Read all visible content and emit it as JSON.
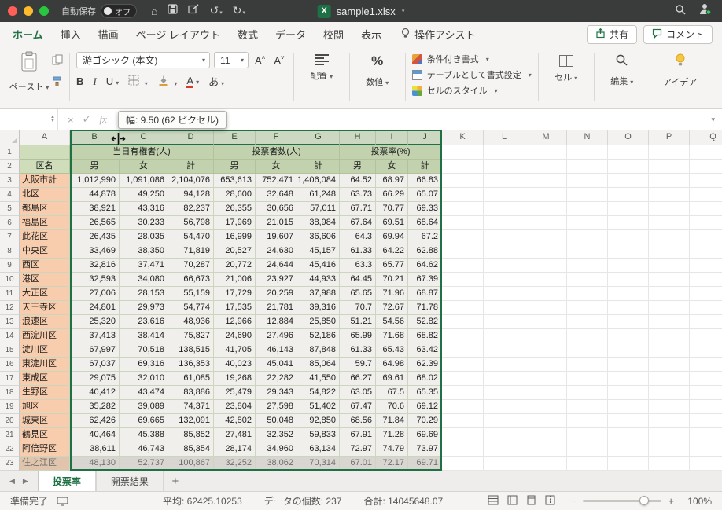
{
  "colors": {
    "accent_green": "#217346",
    "selection_border": "#1f7145",
    "header_fill": "#cfddbb",
    "name_column_fill": "#f8cdad",
    "titlebar_background": "#3a3c3b"
  },
  "titlebar": {
    "autosave_label": "自動保存",
    "autosave_state": "オフ",
    "filename": "sample1.xlsx",
    "icons": {
      "home": "⌂",
      "undo": "↺",
      "redo": "↻"
    }
  },
  "ribbon_tabs": {
    "tabs": [
      {
        "label": "ホーム"
      },
      {
        "label": "挿入"
      },
      {
        "label": "描画"
      },
      {
        "label": "ページ レイアウト"
      },
      {
        "label": "数式"
      },
      {
        "label": "データ"
      },
      {
        "label": "校閲"
      },
      {
        "label": "表示"
      }
    ],
    "active_tab": "ホーム",
    "assistant_label": "操作アシスト",
    "share_label": "共有",
    "comments_label": "コメント"
  },
  "ribbon": {
    "paste_label": "ペースト",
    "font_name": "游ゴシック (本文)",
    "font_size": "11",
    "icons": {
      "grow_font": "A",
      "shrink_font": "A",
      "bold": "B",
      "italic": "I",
      "underline": "U",
      "percent": "%",
      "phonetic": "あ",
      "font_color": "A"
    },
    "alignment_label": "配置",
    "number_label": "数値",
    "conditional_format_label": "条件付き書式",
    "format_as_table_label": "テーブルとして書式設定",
    "cell_styles_label": "セルのスタイル",
    "cells_label": "セル",
    "editing_label": "編集",
    "ideas_label": "アイデア"
  },
  "formula_bar": {
    "tooltip": "幅: 9.50 (62 ピクセル)",
    "cancel_icon": "×",
    "enter_icon": "✓",
    "fx_icon": "fx"
  },
  "sheet": {
    "col_letters": [
      "A",
      "B",
      "C",
      "D",
      "E",
      "F",
      "G",
      "H",
      "I",
      "J",
      "K",
      "L",
      "M",
      "N",
      "O",
      "P",
      "Q"
    ],
    "selected_cols": [
      "B",
      "C",
      "D",
      "E",
      "F",
      "G",
      "H",
      "I",
      "J"
    ],
    "row_count": 23,
    "group_headers": [
      "当日有権者(人)",
      "投票者数(人)",
      "投票率(%)"
    ],
    "sub_headers": [
      "区名",
      "男",
      "女",
      "計",
      "男",
      "女",
      "計",
      "男",
      "女",
      "計"
    ],
    "data_rows": [
      [
        "大阪市計",
        "1,012,990",
        "1,091,086",
        "2,104,076",
        "653,613",
        "752,471",
        "1,406,084",
        "64.52",
        "68.97",
        "66.83"
      ],
      [
        "北区",
        "44,878",
        "49,250",
        "94,128",
        "28,600",
        "32,648",
        "61,248",
        "63.73",
        "66.29",
        "65.07"
      ],
      [
        "都島区",
        "38,921",
        "43,316",
        "82,237",
        "26,355",
        "30,656",
        "57,011",
        "67.71",
        "70.77",
        "69.33"
      ],
      [
        "福島区",
        "26,565",
        "30,233",
        "56,798",
        "17,969",
        "21,015",
        "38,984",
        "67.64",
        "69.51",
        "68.64"
      ],
      [
        "此花区",
        "26,435",
        "28,035",
        "54,470",
        "16,999",
        "19,607",
        "36,606",
        "64.3",
        "69.94",
        "67.2"
      ],
      [
        "中央区",
        "33,469",
        "38,350",
        "71,819",
        "20,527",
        "24,630",
        "45,157",
        "61.33",
        "64.22",
        "62.88"
      ],
      [
        "西区",
        "32,816",
        "37,471",
        "70,287",
        "20,772",
        "24,644",
        "45,416",
        "63.3",
        "65.77",
        "64.62"
      ],
      [
        "港区",
        "32,593",
        "34,080",
        "66,673",
        "21,006",
        "23,927",
        "44,933",
        "64.45",
        "70.21",
        "67.39"
      ],
      [
        "大正区",
        "27,006",
        "28,153",
        "55,159",
        "17,729",
        "20,259",
        "37,988",
        "65.65",
        "71.96",
        "68.87"
      ],
      [
        "天王寺区",
        "24,801",
        "29,973",
        "54,774",
        "17,535",
        "21,781",
        "39,316",
        "70.7",
        "72.67",
        "71.78"
      ],
      [
        "浪速区",
        "25,320",
        "23,616",
        "48,936",
        "12,966",
        "12,884",
        "25,850",
        "51.21",
        "54.56",
        "52.82"
      ],
      [
        "西淀川区",
        "37,413",
        "38,414",
        "75,827",
        "24,690",
        "27,496",
        "52,186",
        "65.99",
        "71.68",
        "68.82"
      ],
      [
        "淀川区",
        "67,997",
        "70,518",
        "138,515",
        "41,705",
        "46,143",
        "87,848",
        "61.33",
        "65.43",
        "63.42"
      ],
      [
        "東淀川区",
        "67,037",
        "69,316",
        "136,353",
        "40,023",
        "45,041",
        "85,064",
        "59.7",
        "64.98",
        "62.39"
      ],
      [
        "東成区",
        "29,075",
        "32,010",
        "61,085",
        "19,268",
        "22,282",
        "41,550",
        "66.27",
        "69.61",
        "68.02"
      ],
      [
        "生野区",
        "40,412",
        "43,474",
        "83,886",
        "25,479",
        "29,343",
        "54,822",
        "63.05",
        "67.5",
        "65.35"
      ],
      [
        "旭区",
        "35,282",
        "39,089",
        "74,371",
        "23,804",
        "27,598",
        "51,402",
        "67.47",
        "70.6",
        "69.12"
      ],
      [
        "城東区",
        "62,426",
        "69,665",
        "132,091",
        "42,802",
        "50,048",
        "92,850",
        "68.56",
        "71.84",
        "70.29"
      ],
      [
        "鶴見区",
        "40,464",
        "45,388",
        "85,852",
        "27,481",
        "32,352",
        "59,833",
        "67.91",
        "71.28",
        "69.69"
      ],
      [
        "阿倍野区",
        "38,611",
        "46,743",
        "85,354",
        "28,174",
        "34,960",
        "63,134",
        "72.97",
        "74.79",
        "73.97"
      ],
      [
        "住之江区",
        "48,130",
        "52,737",
        "100,867",
        "32,252",
        "38,062",
        "70,314",
        "67.01",
        "72.17",
        "69.71"
      ]
    ]
  },
  "sheet_tabs": {
    "prev_icon": "◀",
    "next_icon": "▶",
    "tabs": [
      {
        "label": "投票率",
        "active": true
      },
      {
        "label": "開票結果",
        "active": false
      }
    ],
    "add_label": "+"
  },
  "status_bar": {
    "ready": "準備完了",
    "average": "平均: 62425.10253",
    "count": "データの個数: 237",
    "sum": "合計: 14045648.07",
    "zoom_out_icon": "−",
    "zoom_in_icon": "+",
    "zoom_level": "100%"
  }
}
